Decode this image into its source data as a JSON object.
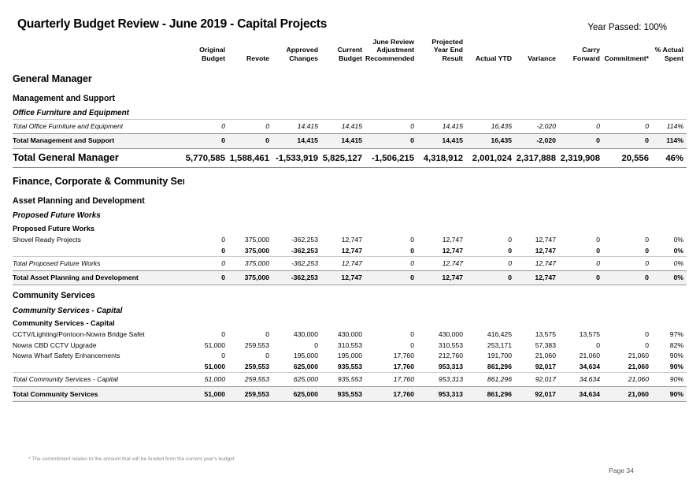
{
  "header": {
    "title": "Quarterly Budget Review - June 2019 - Capital Projects",
    "year_passed": "Year Passed: 100%"
  },
  "columns": [
    {
      "key": "label",
      "label": ""
    },
    {
      "key": "original",
      "label": "Original Budget"
    },
    {
      "key": "revote",
      "label": "Revote"
    },
    {
      "key": "approved",
      "label": "Approved Changes"
    },
    {
      "key": "current",
      "label": "Current Budget"
    },
    {
      "key": "adjustment",
      "label": "June Review Adjustment Recommended"
    },
    {
      "key": "projected",
      "label": "Projected Year End Result"
    },
    {
      "key": "actual_ytd",
      "label": "Actual YTD"
    },
    {
      "key": "variance",
      "label": "Variance"
    },
    {
      "key": "carry",
      "label": "Carry Forward"
    },
    {
      "key": "commitment",
      "label": "Commitment*"
    },
    {
      "key": "pct_spent",
      "label": "% Actual Spent"
    }
  ],
  "rows": [
    {
      "type": "section-head",
      "indent": 0,
      "label": "General Manager",
      "values": []
    },
    {
      "type": "subsection-head",
      "indent": 0,
      "label": "Management and Support",
      "values": []
    },
    {
      "type": "group-italic",
      "indent": 2,
      "label": "Office Furniture and Equipment",
      "values": []
    },
    {
      "type": "total-italic",
      "indent": 3,
      "label": "Total Office Furniture and Equipment",
      "values": [
        "0",
        "0",
        "14,415",
        "14,415",
        "0",
        "14,415",
        "16,435",
        "-2,020",
        "0",
        "0",
        "114%"
      ]
    },
    {
      "type": "total-bold",
      "indent": 1,
      "label": "Total Management and Support",
      "values": [
        "0",
        "0",
        "14,415",
        "14,415",
        "0",
        "14,415",
        "16,435",
        "-2,020",
        "0",
        "0",
        "114%"
      ]
    },
    {
      "type": "total-major",
      "indent": 0,
      "label": "Total General Manager",
      "values": [
        "5,770,585",
        "1,588,461",
        "-1,533,919",
        "5,825,127",
        "-1,506,215",
        "4,318,912",
        "2,001,024",
        "2,317,888",
        "2,319,908",
        "20,556",
        "46%"
      ]
    },
    {
      "type": "section-head",
      "indent": 0,
      "label": "Finance, Corporate & Community Services",
      "values": []
    },
    {
      "type": "subsection-head",
      "indent": 0,
      "label": "Asset Planning and Development",
      "values": []
    },
    {
      "type": "group-italic",
      "indent": 2,
      "label": "Proposed Future Works",
      "values": []
    },
    {
      "type": "group-plain",
      "indent": 3,
      "label": "Proposed Future Works",
      "values": []
    },
    {
      "type": "item",
      "indent": 4,
      "label": "Shovel Ready Projects",
      "values": [
        "0",
        "375,000",
        "-362,253",
        "12,747",
        "0",
        "12,747",
        "0",
        "12,747",
        "0",
        "0",
        "0%"
      ]
    },
    {
      "type": "subtotal-plain",
      "indent": 4,
      "label": "",
      "values": [
        "0",
        "375,000",
        "-362,253",
        "12,747",
        "0",
        "12,747",
        "0",
        "12,747",
        "0",
        "0",
        "0%"
      ]
    },
    {
      "type": "total-italic",
      "indent": 3,
      "label": "Total Proposed Future Works",
      "values": [
        "0",
        "375,000",
        "-362,253",
        "12,747",
        "0",
        "12,747",
        "0",
        "12,747",
        "0",
        "0",
        "0%"
      ]
    },
    {
      "type": "total-bold",
      "indent": 1,
      "label": "Total Asset Planning and Development",
      "values": [
        "0",
        "375,000",
        "-362,253",
        "12,747",
        "0",
        "12,747",
        "0",
        "12,747",
        "0",
        "0",
        "0%"
      ]
    },
    {
      "type": "subsection-head",
      "indent": 0,
      "label": "Community Services",
      "values": []
    },
    {
      "type": "group-italic",
      "indent": 2,
      "label": "Community Services - Capital",
      "values": []
    },
    {
      "type": "group-plain",
      "indent": 3,
      "label": "Community Services - Capital",
      "values": []
    },
    {
      "type": "item",
      "indent": 4,
      "label": "CCTV/Lighting/Pontoon-Nowra Bridge Safet",
      "values": [
        "0",
        "0",
        "430,000",
        "430,000",
        "0",
        "430,000",
        "416,425",
        "13,575",
        "13,575",
        "0",
        "97%"
      ]
    },
    {
      "type": "item",
      "indent": 4,
      "label": "Nowra CBD CCTV Upgrade",
      "values": [
        "51,000",
        "259,553",
        "0",
        "310,553",
        "0",
        "310,553",
        "253,171",
        "57,383",
        "0",
        "0",
        "82%"
      ]
    },
    {
      "type": "item",
      "indent": 4,
      "label": "Nowra Wharf Safety Enhancements",
      "values": [
        "0",
        "0",
        "195,000",
        "195,000",
        "17,760",
        "212,760",
        "191,700",
        "21,060",
        "21,060",
        "21,060",
        "90%"
      ]
    },
    {
      "type": "subtotal-plain",
      "indent": 4,
      "label": "",
      "values": [
        "51,000",
        "259,553",
        "625,000",
        "935,553",
        "17,760",
        "953,313",
        "861,296",
        "92,017",
        "34,634",
        "21,060",
        "90%"
      ]
    },
    {
      "type": "total-italic",
      "indent": 3,
      "label": "Total Community Services - Capital",
      "values": [
        "51,000",
        "259,553",
        "625,000",
        "935,553",
        "17,760",
        "953,313",
        "861,296",
        "92,017",
        "34,634",
        "21,060",
        "90%"
      ]
    },
    {
      "type": "total-bold",
      "indent": 1,
      "label": "Total Community Services",
      "values": [
        "51,000",
        "259,553",
        "625,000",
        "935,553",
        "17,760",
        "953,313",
        "861,296",
        "92,017",
        "34,634",
        "21,060",
        "90%"
      ]
    }
  ],
  "footer": {
    "footnote": "* The commitment relates to the amount that will be funded from the current year's budget",
    "page_number": "Page 34"
  }
}
